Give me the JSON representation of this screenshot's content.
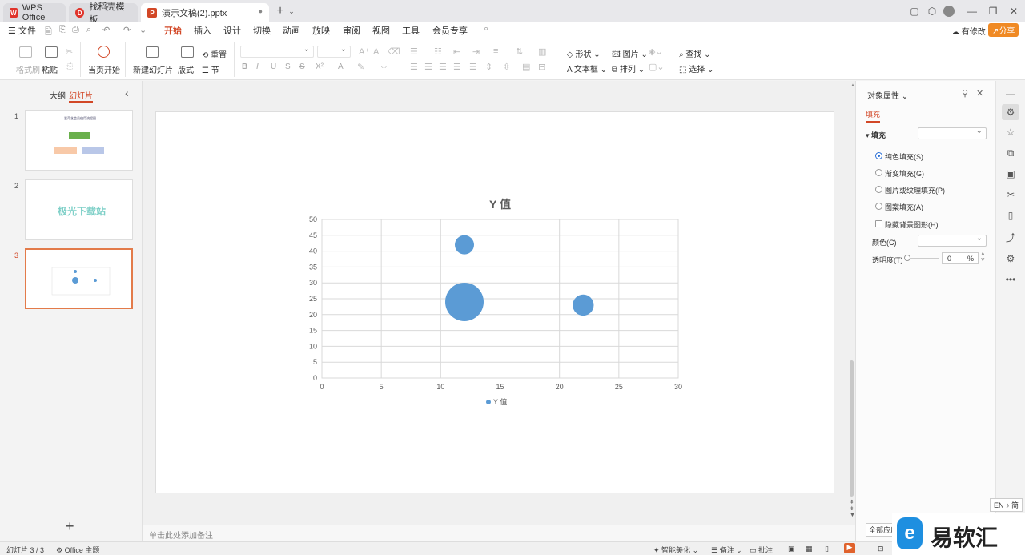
{
  "tabs": [
    {
      "label": "WPS Office",
      "color": "#e0342b"
    },
    {
      "label": "找稻壳模板",
      "color": "#e0342b"
    },
    {
      "label": "演示文稿(2).pptx",
      "color": "#d24726"
    }
  ],
  "menubar": {
    "file": "文件",
    "items": [
      "开始",
      "插入",
      "设计",
      "切换",
      "动画",
      "放映",
      "审阅",
      "视图",
      "工具",
      "会员专享"
    ],
    "active": "开始",
    "has_changes": "有修改",
    "share": "分享"
  },
  "ribbon": {
    "format_painter": "格式刷",
    "paste": "粘贴",
    "play_from_current": "当页开始",
    "new_slide": "新建幻灯片",
    "layout": "版式",
    "reset": "重置",
    "section": "节",
    "shape": "形状",
    "picture": "图片",
    "textbox": "文本框",
    "arrange": "排列",
    "find": "查找",
    "select": "选择",
    "bold": "B",
    "italic": "I",
    "underline": "U",
    "strike": "S",
    "shadow": "S",
    "superscript": "X²",
    "font_color": "A"
  },
  "leftpanel": {
    "outline": "大纲",
    "slides": "幻灯片",
    "collapse": "‹",
    "slide_numbers": [
      "1",
      "2",
      "3"
    ],
    "slide1_title": "爱奇艺会员使用流程图",
    "slide2_text": "极光下载站",
    "add": "+"
  },
  "chart_data": {
    "type": "bubble",
    "title": "Y 值",
    "legend": "Y 值",
    "legend_position": "bottom",
    "color": "#5b9bd5",
    "xlim": [
      0,
      30
    ],
    "ylim": [
      0,
      50
    ],
    "xticks": [
      0,
      5,
      10,
      15,
      20,
      25,
      30
    ],
    "yticks": [
      0,
      5,
      10,
      15,
      20,
      25,
      30,
      35,
      40,
      45,
      50
    ],
    "grid": true,
    "points": [
      {
        "x": 12,
        "y": 42,
        "size": 1.0
      },
      {
        "x": 12,
        "y": 24,
        "size": 4.0
      },
      {
        "x": 22,
        "y": 23,
        "size": 1.2
      }
    ]
  },
  "notes": "单击此处添加备注",
  "rightpanel": {
    "title": "对象属性",
    "tab": "填充",
    "fill_section": "填充",
    "options": [
      "纯色填充(S)",
      "渐变填充(G)",
      "图片或纹理填充(P)",
      "图案填充(A)"
    ],
    "selected_option": "纯色填充(S)",
    "hide_bg": "隐藏背景图形(H)",
    "color_label": "颜色(C)",
    "transparency_label": "透明度(T)",
    "transparency_value": "0",
    "percent": "%",
    "apply_all": "全部应用"
  },
  "statusbar": {
    "slide_count": "幻灯片 3 / 3",
    "theme": "Office 主题",
    "smart_beautify": "智能美化",
    "notes": "备注",
    "comments": "批注"
  },
  "ime": "EN ♪ 简",
  "watermark": "易软汇"
}
